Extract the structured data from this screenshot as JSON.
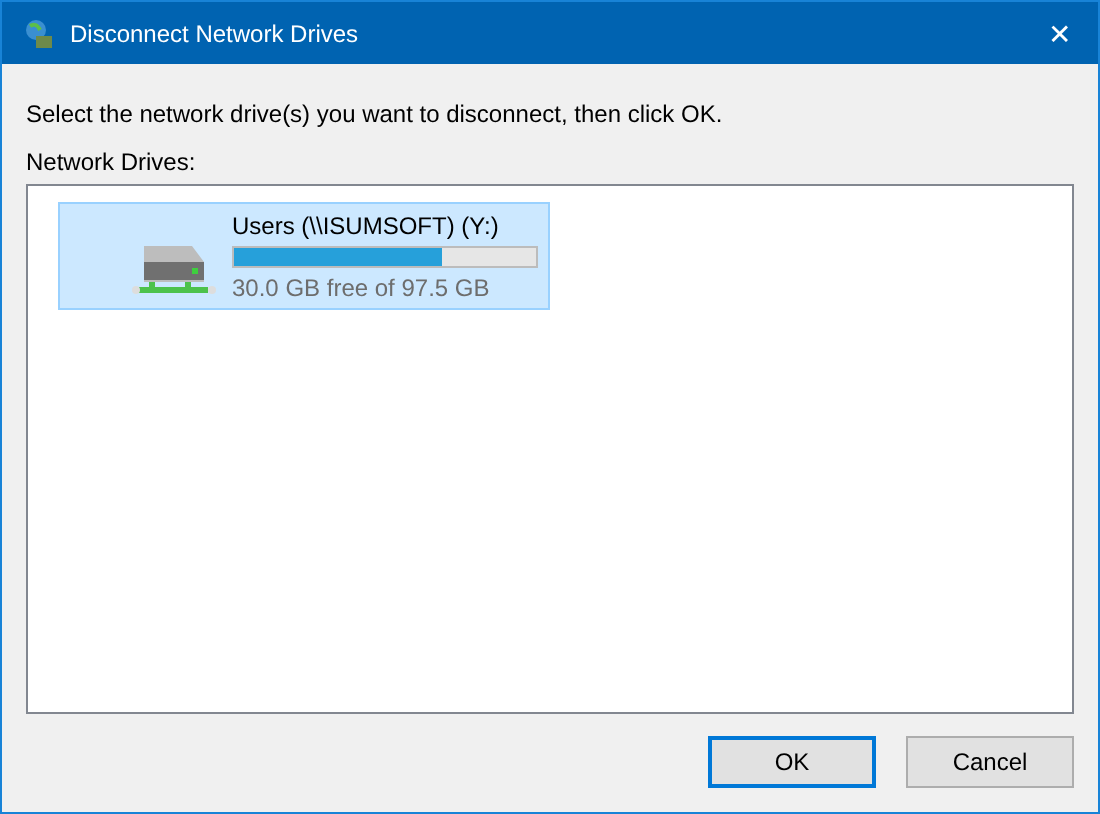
{
  "window": {
    "title": "Disconnect Network Drives",
    "close": "✕"
  },
  "instruction": "Select the network drive(s) you want to disconnect, then click OK.",
  "list_label": "Network Drives:",
  "drives": [
    {
      "name": "Users (\\\\ISUMSOFT) (Y:)",
      "level": 0.69,
      "space": "30.0 GB free of 97.5 GB",
      "selected": true
    }
  ],
  "buttons": [
    {
      "label": "OK",
      "default": true
    },
    {
      "label": "Cancel",
      "default": false
    }
  ]
}
